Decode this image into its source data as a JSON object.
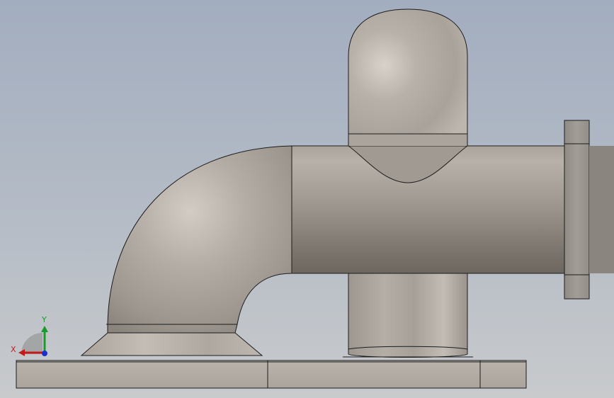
{
  "viewport": {
    "background_top": "#a3aec0",
    "background_bottom": "#c6c9cc",
    "part_color": "#b5afa8",
    "edge_color": "#1c1c1c"
  },
  "triad": {
    "x_label": "X",
    "y_label": "Y",
    "x_color": "#c41a1a",
    "y_color": "#1a9a2a",
    "z_color": "#1a2fd0"
  }
}
